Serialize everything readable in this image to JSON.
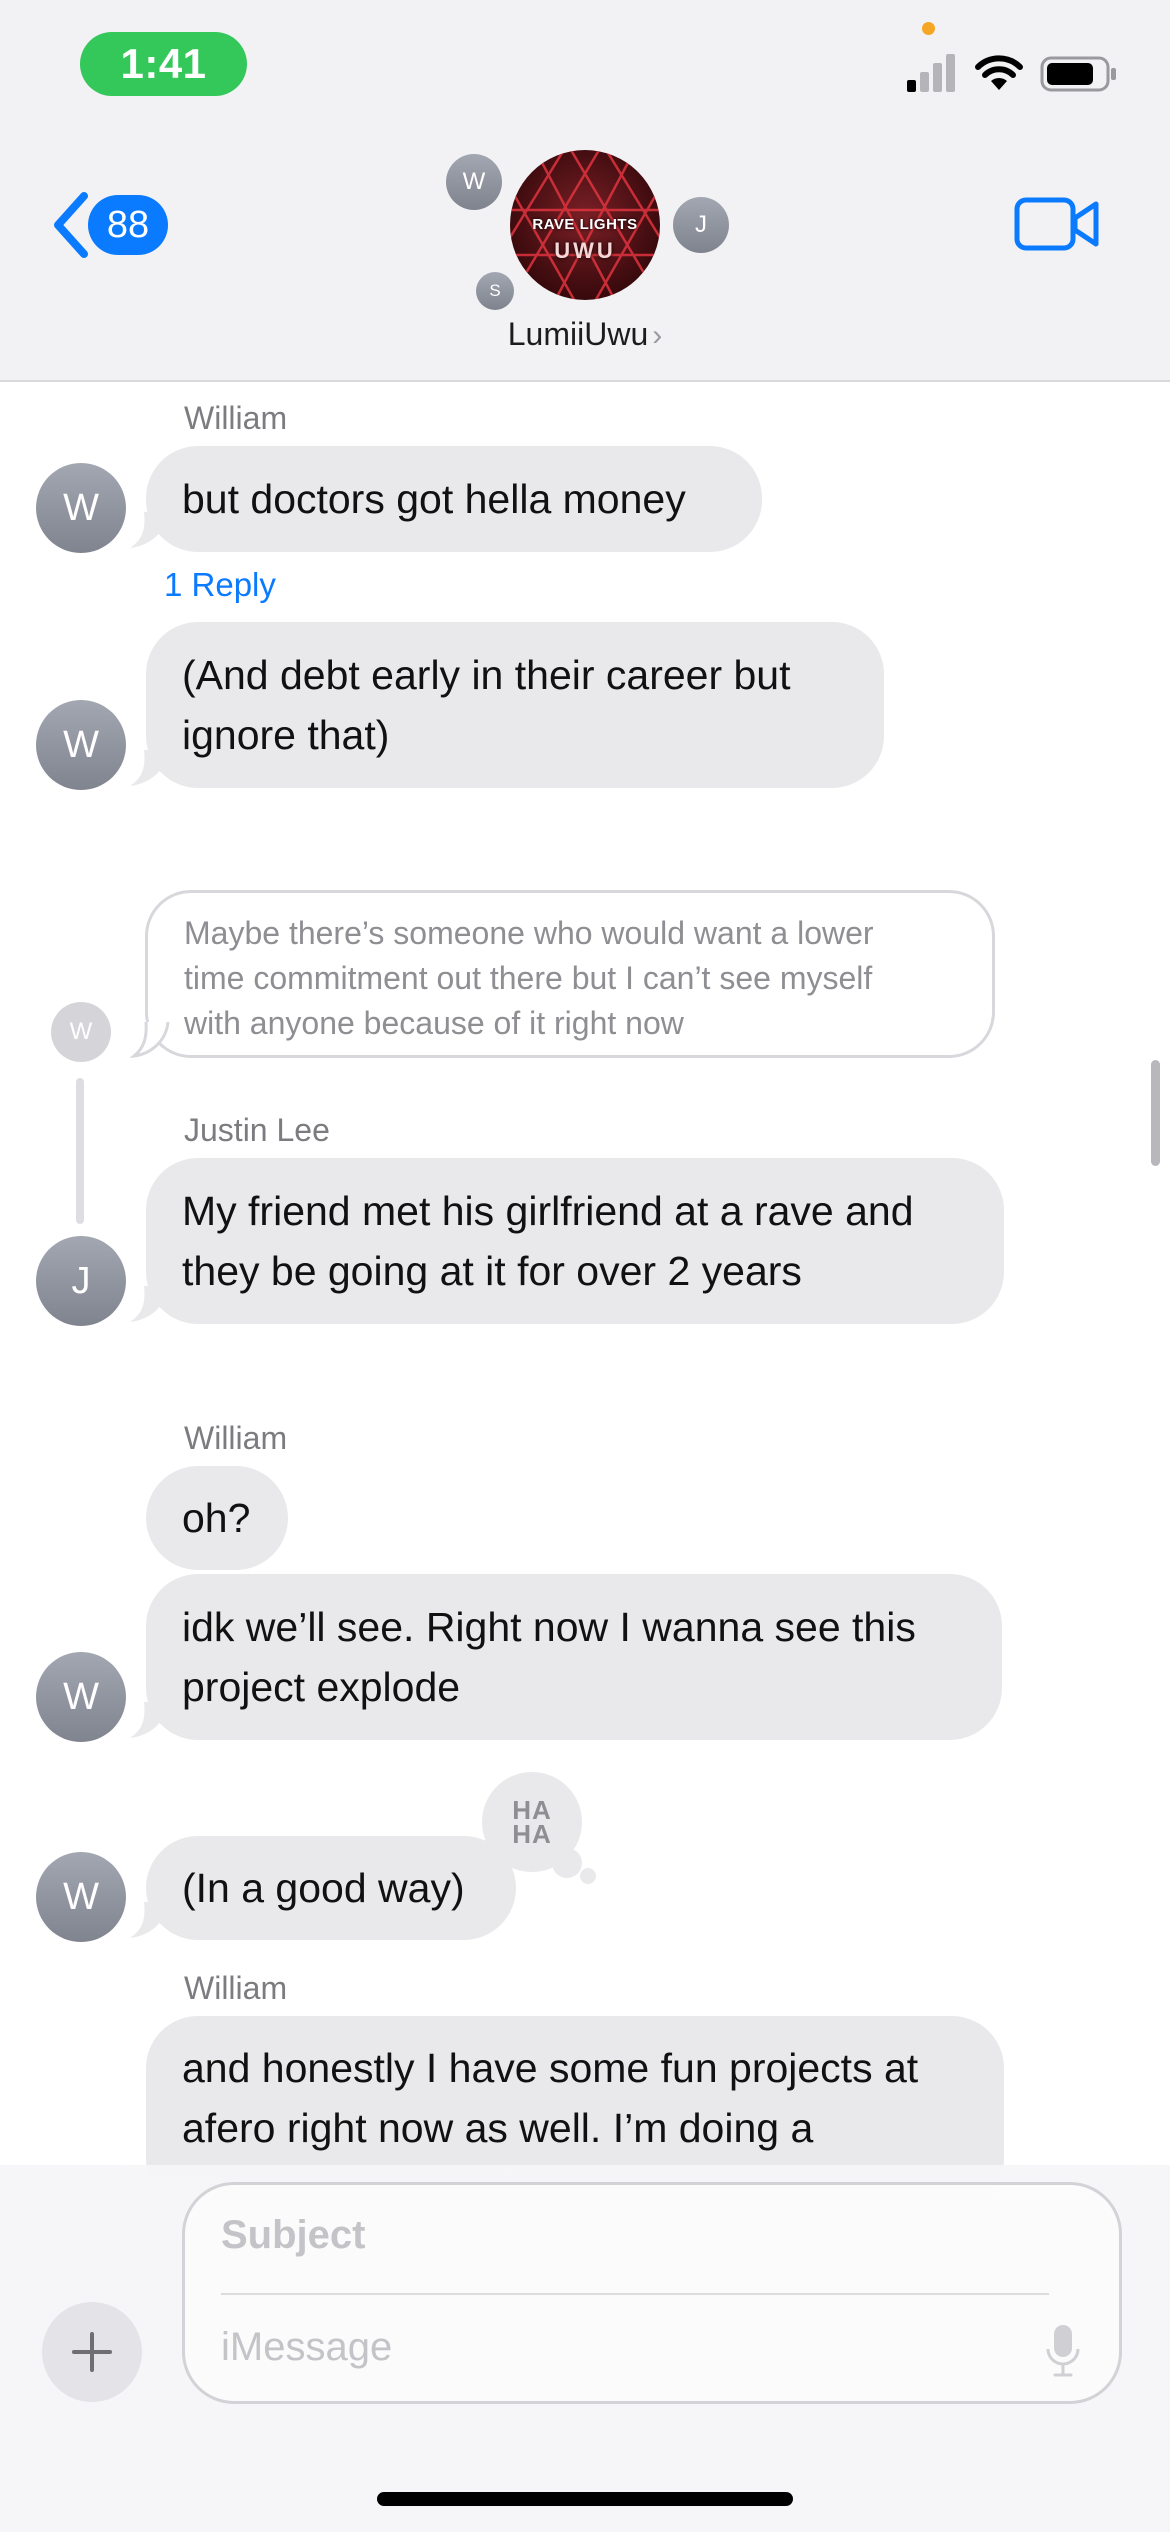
{
  "status_bar": {
    "time": "1:41",
    "icons": [
      "signal-icon",
      "wifi-icon",
      "battery-icon"
    ],
    "colors": {
      "time_pill": "#34c759",
      "privacy_dot": "#f5a623"
    }
  },
  "header": {
    "back_badge": "88",
    "group_name": "LumiiUwu",
    "group_avatar": {
      "title": "RAVE LIGHTS",
      "subtitle": "UWU"
    },
    "member_avatars": [
      "W",
      "J",
      "S"
    ],
    "accent_color": "#0a7aff"
  },
  "messages": [
    {
      "sender": "William",
      "avatar": "W",
      "text": "but doctors got hella money",
      "replies": "1 Reply"
    },
    {
      "avatar": "W",
      "lines": [
        "(And debt early in their career but",
        "ignore that)"
      ]
    },
    {
      "quoted_avatar": "W",
      "quoted_lines": [
        "Maybe there’s someone who would want a lower",
        "time commitment out there but I can’t see myself",
        "with anyone because of it right now"
      ]
    },
    {
      "sender": "Justin Lee",
      "avatar": "J",
      "lines": [
        "My friend met his girlfriend at a rave and",
        "they be going at it for over 2 years"
      ]
    },
    {
      "sender": "William",
      "text": "oh?"
    },
    {
      "avatar": "W",
      "lines": [
        "idk we’ll see. Right now I wanna see this",
        "project explode"
      ]
    },
    {
      "avatar": "W",
      "text": "(In a good way)",
      "tapback": [
        "HA",
        "HA"
      ]
    },
    {
      "sender": "William",
      "lines": [
        "and honestly I have some fun projects at",
        "afero right now as well. I’m doing a"
      ]
    }
  ],
  "composer": {
    "subject_placeholder": "Subject",
    "message_placeholder": "iMessage"
  }
}
